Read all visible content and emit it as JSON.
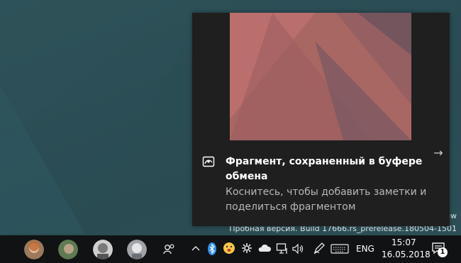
{
  "desktop": {
    "watermark_line1": "ew",
    "watermark_line2": "Пробная версия. Build 17666.rs_prerelease.180504-1501"
  },
  "toast": {
    "title": "Фрагмент, сохраненный в буфере обмена",
    "body": "Коснитесь, чтобы добавить заметки и поделиться фрагментом",
    "icon": "screen-snip-icon",
    "action_icon": "arrow-right-icon"
  },
  "taskbar": {
    "people": [
      "person-1-avatar",
      "person-2-avatar",
      "person-3-avatar",
      "person-4-avatar"
    ],
    "language": "ENG",
    "time": "15:07",
    "date": "16.05.2018",
    "notification_count": "1",
    "tray_icons": [
      "people-icon",
      "chevron-up-icon",
      "bluetooth-icon",
      "emoji-icon",
      "settings-gear-icon",
      "onedrive-cloud-icon",
      "network-icon",
      "volume-icon",
      "pen-icon",
      "keyboard-icon",
      "action-center-icon"
    ]
  },
  "colors": {
    "desktop_bg": "#2c4f56",
    "toast_bg": "#1f1f1f",
    "taskbar_bg": "#101214",
    "bluetooth": "#2d8ff0",
    "snip_pink": "#b26a67"
  }
}
